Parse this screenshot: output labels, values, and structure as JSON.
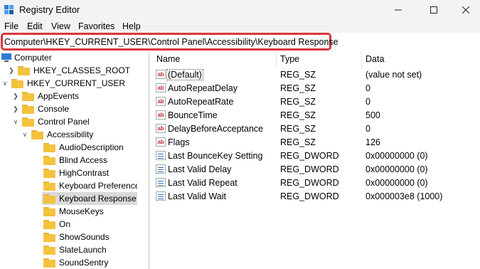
{
  "window": {
    "title": "Registry Editor",
    "minimize_icon": "minimize-icon",
    "maximize_icon": "maximize-icon",
    "close_icon": "close-icon"
  },
  "menu": [
    "File",
    "Edit",
    "View",
    "Favorites",
    "Help"
  ],
  "address": {
    "path": "Computer\\HKEY_CURRENT_USER\\Control Panel\\Accessibility\\Keyboard Response",
    "highlight_color": "#d9373c"
  },
  "tree": [
    {
      "label": "Computer",
      "icon": "computer-icon"
    },
    {
      "label": "HKEY_CLASSES_ROOT",
      "chevron": "right"
    },
    {
      "label": "HKEY_CURRENT_USER",
      "chevron": "down"
    },
    {
      "label": "AppEvents",
      "chevron": "right"
    },
    {
      "label": "Console",
      "chevron": "right"
    },
    {
      "label": "Control Panel",
      "chevron": "down"
    },
    {
      "label": "Accessibility",
      "chevron": "down"
    },
    {
      "label": "AudioDescription"
    },
    {
      "label": "Blind Access"
    },
    {
      "label": "HighContrast"
    },
    {
      "label": "Keyboard Preference"
    },
    {
      "label": "Keyboard Response",
      "selected": true
    },
    {
      "label": "MouseKeys"
    },
    {
      "label": "On"
    },
    {
      "label": "ShowSounds"
    },
    {
      "label": "SlateLaunch"
    },
    {
      "label": "SoundSentry"
    }
  ],
  "columns": [
    "Name",
    "Type",
    "Data"
  ],
  "values": [
    {
      "name": "(Default)",
      "type": "REG_SZ",
      "data": "(value not set)",
      "icon": "string-value-icon"
    },
    {
      "name": "AutoRepeatDelay",
      "type": "REG_SZ",
      "data": "0",
      "icon": "string-value-icon"
    },
    {
      "name": "AutoRepeatRate",
      "type": "REG_SZ",
      "data": "0",
      "icon": "string-value-icon"
    },
    {
      "name": "BounceTime",
      "type": "REG_SZ",
      "data": "500",
      "icon": "string-value-icon"
    },
    {
      "name": "DelayBeforeAcceptance",
      "type": "REG_SZ",
      "data": "0",
      "icon": "string-value-icon"
    },
    {
      "name": "Flags",
      "type": "REG_SZ",
      "data": "126",
      "icon": "string-value-icon"
    },
    {
      "name": "Last BounceKey Setting",
      "type": "REG_DWORD",
      "data": "0x00000000 (0)",
      "icon": "binary-value-icon"
    },
    {
      "name": "Last Valid Delay",
      "type": "REG_DWORD",
      "data": "0x00000000 (0)",
      "icon": "binary-value-icon"
    },
    {
      "name": "Last Valid Repeat",
      "type": "REG_DWORD",
      "data": "0x00000000 (0)",
      "icon": "binary-value-icon"
    },
    {
      "name": "Last Valid Wait",
      "type": "REG_DWORD",
      "data": "0x000003e8 (1000)",
      "icon": "binary-value-icon"
    }
  ]
}
